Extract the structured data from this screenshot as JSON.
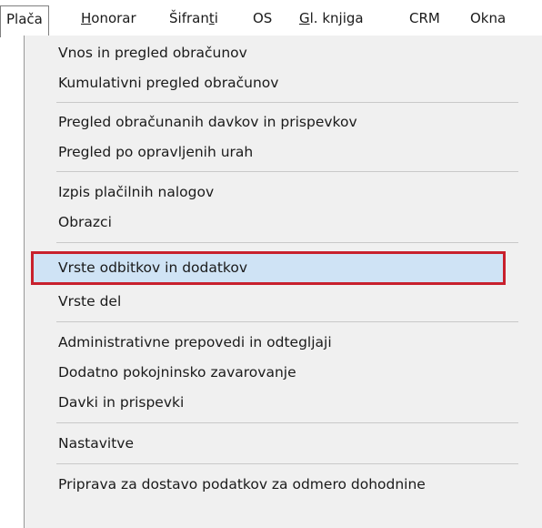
{
  "menubar": {
    "items": [
      {
        "label": "Plača",
        "underline": ""
      },
      {
        "label": "Honorar",
        "underline": "H"
      },
      {
        "label": "Šifranti",
        "underline": "t"
      },
      {
        "label": "OS",
        "underline": ""
      },
      {
        "label": "Gl. knjiga",
        "underline": "G"
      },
      {
        "label": "CRM",
        "underline": ""
      },
      {
        "label": "Okna",
        "underline": ""
      }
    ],
    "active_index": 0
  },
  "dropdown": {
    "items": [
      {
        "label": "Vnos in pregled obračunov"
      },
      {
        "label": "Kumulativni pregled obračunov"
      },
      {
        "label": "Pregled obračunanih davkov in prispevkov"
      },
      {
        "label": "Pregled po opravljenih urah"
      },
      {
        "label": "Izpis plačilnih nalogov"
      },
      {
        "label": "Obrazci"
      },
      {
        "label": "Vrste odbitkov in dodatkov",
        "selected": true
      },
      {
        "label": "Vrste del"
      },
      {
        "label": "Administrativne prepovedi in odtegljaji"
      },
      {
        "label": "Dodatno pokojninsko zavarovanje"
      },
      {
        "label": "Davki in prispevki"
      },
      {
        "label": "Nastavitve"
      },
      {
        "label": "Priprava za dostavo podatkov za odmero dohodnine"
      }
    ]
  },
  "colors": {
    "selection_fill": "#cfe3f5",
    "selection_border": "#c8202d",
    "menu_background": "#f0f0f0"
  }
}
